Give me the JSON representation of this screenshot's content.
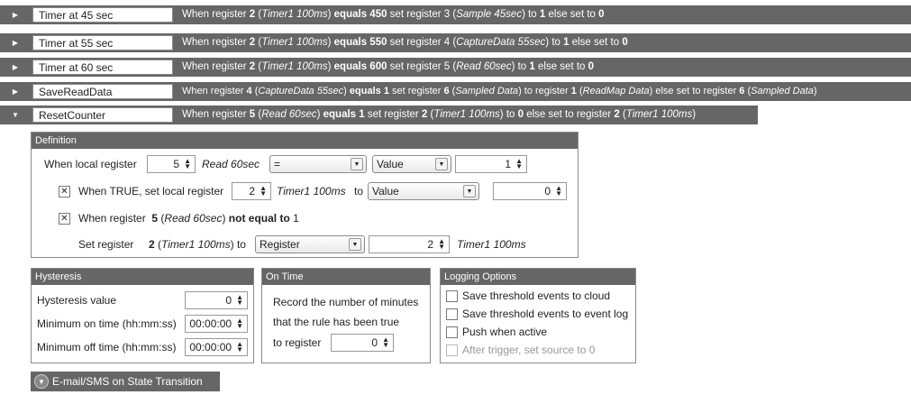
{
  "rules": [
    {
      "name": "Timer at 45 sec",
      "description": {
        "prefix": "When register ",
        "reg": "2",
        "reg_name": "Timer1 100ms",
        "op": "equals",
        "value": "450",
        "mid": " set register ",
        "target": "3",
        "target_name": "Sample 45sec",
        "to": " to ",
        "to_value": "1",
        "else": " else set to ",
        "else_value": "0"
      }
    },
    {
      "name": "Timer at 55 sec",
      "description": {
        "prefix": "When register ",
        "reg": "2",
        "reg_name": "Timer1 100ms",
        "op": "equals",
        "value": "550",
        "mid": " set register ",
        "target": "4",
        "target_name": "CaptureData 55sec",
        "to": " to ",
        "to_value": "1",
        "else": " else set to ",
        "else_value": "0"
      }
    },
    {
      "name": "Timer at 60 sec",
      "description": {
        "prefix": "When register ",
        "reg": "2",
        "reg_name": "Timer1 100ms",
        "op": "equals",
        "value": "600",
        "mid": " set register ",
        "target": "5",
        "target_name": "Read 60sec",
        "to": " to ",
        "to_value": "1",
        "else": " else set to ",
        "else_value": "0"
      }
    },
    {
      "name": "SaveReadData",
      "description": {
        "prefix": "When register ",
        "reg": "4",
        "reg_name": "CaptureData 55sec",
        "op": "equals",
        "value": "1",
        "mid": " set register ",
        "target": "6",
        "target_name": "Sampled Data",
        "to": " to  register ",
        "to_value": "1",
        "to_name": "ReadMap Data",
        "else": " else set to register ",
        "else_value": "6",
        "else_name": "Sampled Data"
      }
    },
    {
      "name": "ResetCounter",
      "description": {
        "prefix": "When register ",
        "reg": "5",
        "reg_name": "Read 60sec",
        "op": "equals",
        "value": "1",
        "mid": " set register ",
        "target": "2",
        "target_name": "Timer1 100ms",
        "to": " to ",
        "to_value": "0",
        "else": " else set to register ",
        "else_value": "2",
        "else_name": "Timer1 100ms"
      }
    }
  ],
  "definition": {
    "title": "Definition",
    "when_local_register_label": "When local register",
    "register_value": "5",
    "register_name": "Read 60sec",
    "operator": "=",
    "compare_type": "Value",
    "compare_value": "1",
    "when_true_label": "When TRUE, set local register",
    "true_register": "2",
    "true_register_name": "Timer1 100ms",
    "to_label": "to",
    "true_type": "Value",
    "true_value": "0",
    "when_register_label": "When register",
    "not_equal_reg": "5",
    "not_equal_name": "Read 60sec",
    "not_equal_text": "not equal to",
    "not_equal_value": "1",
    "set_register_label": "Set register",
    "set_reg": "2",
    "set_reg_name": "Timer1 100ms",
    "set_to_label": "to",
    "set_type": "Register",
    "set_value": "2",
    "set_value_name": "Timer1 100ms"
  },
  "hysteresis": {
    "title": "Hysteresis",
    "value_label": "Hysteresis value",
    "value": "0",
    "min_on_label": "Minimum on time (hh:mm:ss)",
    "min_on": "00:00:00",
    "min_off_label": "Minimum off time (hh:mm:ss)",
    "min_off": "00:00:00"
  },
  "on_time": {
    "title": "On Time",
    "line1": "Record the number of minutes",
    "line2": "that the rule has been true",
    "register_label": "to register",
    "register_value": "0"
  },
  "logging": {
    "title": "Logging Options",
    "options": [
      "Save threshold events to cloud",
      "Save threshold events to event log",
      "Push when active",
      "After trigger, set source to 0"
    ]
  },
  "email_button": "E-mail/SMS on State Transition"
}
